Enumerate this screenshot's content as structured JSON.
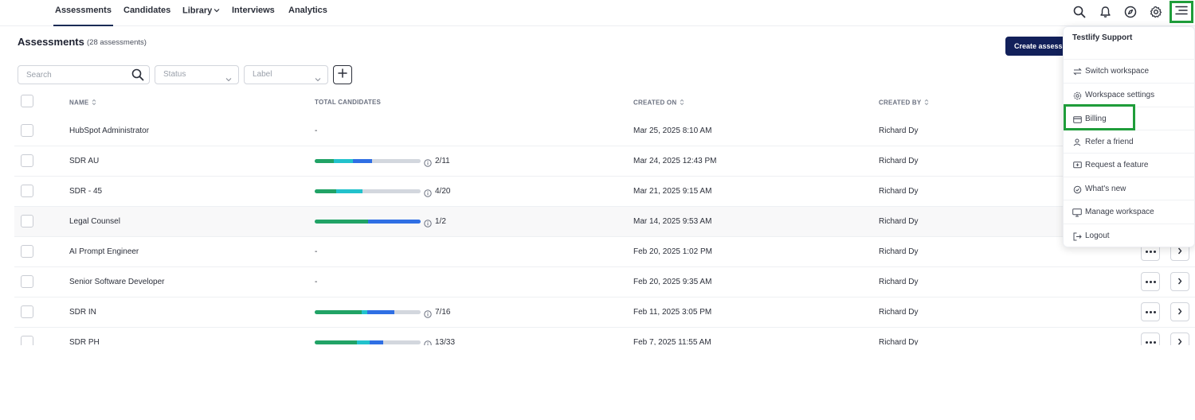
{
  "nav": {
    "items": [
      {
        "label": "Assessments",
        "active": true
      },
      {
        "label": "Candidates",
        "active": false
      },
      {
        "label": "Library",
        "active": false,
        "dropdown": true
      },
      {
        "label": "Interviews",
        "active": false
      },
      {
        "label": "Analytics",
        "active": false
      }
    ],
    "icons": [
      "search-icon",
      "bell-icon",
      "compass-icon",
      "gear-icon",
      "menu-icon"
    ]
  },
  "header": {
    "title": "Assessments",
    "count": "(28 assessments)",
    "create_label": "Create assessment"
  },
  "filters": {
    "search_placeholder": "Search",
    "status_placeholder": "Status",
    "label_placeholder": "Label"
  },
  "table": {
    "columns": {
      "name": "NAME",
      "total": "TOTAL CANDIDATES",
      "created_on": "CREATED ON",
      "created_by": "CREATED BY"
    },
    "rows": [
      {
        "name": "HubSpot Administrator",
        "total": "-",
        "ratio": null,
        "progress": null,
        "created_on": "Mar 25, 2025 8:10 AM",
        "created_by": "Richard Dy"
      },
      {
        "name": "SDR AU",
        "total": null,
        "ratio": "2/11",
        "progress": [
          0.18,
          0.18,
          0.18
        ],
        "created_on": "Mar 24, 2025 12:43 PM",
        "created_by": "Richard Dy"
      },
      {
        "name": "SDR - 45",
        "total": null,
        "ratio": "4/20",
        "progress": [
          0.2,
          0.25,
          0
        ],
        "created_on": "Mar 21, 2025 9:15 AM",
        "created_by": "Richard Dy"
      },
      {
        "name": "Legal Counsel",
        "total": null,
        "ratio": "1/2",
        "progress": [
          0.5,
          0,
          0.5
        ],
        "created_on": "Mar 14, 2025 9:53 AM",
        "created_by": "Richard Dy"
      },
      {
        "name": "AI Prompt Engineer",
        "total": "-",
        "ratio": null,
        "progress": null,
        "created_on": "Feb 20, 2025 1:02 PM",
        "created_by": "Richard Dy"
      },
      {
        "name": "Senior Software Developer",
        "total": "-",
        "ratio": null,
        "progress": null,
        "created_on": "Feb 20, 2025 9:35 AM",
        "created_by": "Richard Dy"
      },
      {
        "name": "SDR IN",
        "total": null,
        "ratio": "7/16",
        "progress": [
          0.44,
          0.06,
          0.25
        ],
        "created_on": "Feb 11, 2025 3:05 PM",
        "created_by": "Richard Dy"
      },
      {
        "name": "SDR PH",
        "total": null,
        "ratio": "13/33",
        "progress": [
          0.4,
          0.12,
          0.13
        ],
        "created_on": "Feb 7, 2025 11:55 AM",
        "created_by": "Richard Dy"
      }
    ],
    "progress_colors": [
      "#21a366",
      "#22c2cc",
      "#2f6fe4"
    ]
  },
  "dropdown": {
    "header": "Testlify Support",
    "items": [
      {
        "label": "Switch workspace",
        "icon": "swap-icon"
      },
      {
        "label": "Workspace settings",
        "icon": "gear-icon"
      },
      {
        "label": "Billing",
        "icon": "card-icon"
      },
      {
        "label": "Refer a friend",
        "icon": "user-icon"
      },
      {
        "label": "Request a feature",
        "icon": "feature-icon"
      },
      {
        "label": "What's new",
        "icon": "check-circle-icon"
      },
      {
        "label": "Manage workspace",
        "icon": "monitor-icon"
      },
      {
        "label": "Logout",
        "icon": "logout-icon"
      }
    ],
    "highlighted": "Billing"
  },
  "colors": {
    "primary": "#12205a",
    "highlight": "#1f9d3a"
  }
}
